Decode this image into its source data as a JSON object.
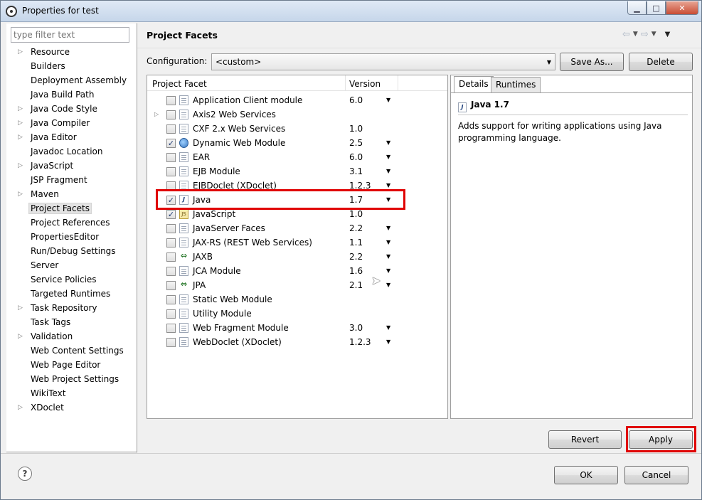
{
  "window": {
    "title": "Properties for test",
    "controls": {
      "minimize": "▁",
      "maximize": "□",
      "close": "✕"
    }
  },
  "sidebar": {
    "filter_placeholder": "type filter text",
    "items": [
      {
        "label": "Resource",
        "expandable": true
      },
      {
        "label": "Builders",
        "expandable": false
      },
      {
        "label": "Deployment Assembly",
        "expandable": false
      },
      {
        "label": "Java Build Path",
        "expandable": false
      },
      {
        "label": "Java Code Style",
        "expandable": true
      },
      {
        "label": "Java Compiler",
        "expandable": true
      },
      {
        "label": "Java Editor",
        "expandable": true
      },
      {
        "label": "Javadoc Location",
        "expandable": false
      },
      {
        "label": "JavaScript",
        "expandable": true
      },
      {
        "label": "JSP Fragment",
        "expandable": false
      },
      {
        "label": "Maven",
        "expandable": true
      },
      {
        "label": "Project Facets",
        "expandable": false,
        "selected": true
      },
      {
        "label": "Project References",
        "expandable": false
      },
      {
        "label": "PropertiesEditor",
        "expandable": false
      },
      {
        "label": "Run/Debug Settings",
        "expandable": false
      },
      {
        "label": "Server",
        "expandable": false
      },
      {
        "label": "Service Policies",
        "expandable": false
      },
      {
        "label": "Targeted Runtimes",
        "expandable": false
      },
      {
        "label": "Task Repository",
        "expandable": true
      },
      {
        "label": "Task Tags",
        "expandable": false
      },
      {
        "label": "Validation",
        "expandable": true
      },
      {
        "label": "Web Content Settings",
        "expandable": false
      },
      {
        "label": "Web Page Editor",
        "expandable": false
      },
      {
        "label": "Web Project Settings",
        "expandable": false
      },
      {
        "label": "WikiText",
        "expandable": false
      },
      {
        "label": "XDoclet",
        "expandable": true
      }
    ]
  },
  "page": {
    "title": "Project Facets",
    "configuration_label": "Configuration:",
    "configuration_value": "<custom>",
    "save_as_label": "Save As...",
    "delete_label": "Delete"
  },
  "facets": {
    "col_facet": "Project Facet",
    "col_version": "Version",
    "rows": [
      {
        "name": "Application Client module",
        "version": "6.0",
        "checked": false,
        "dropdown": true,
        "expander": false,
        "icon": "doc"
      },
      {
        "name": "Axis2 Web Services",
        "version": "",
        "checked": false,
        "dropdown": false,
        "expander": true,
        "icon": "doc"
      },
      {
        "name": "CXF 2.x Web Services",
        "version": "1.0",
        "checked": false,
        "dropdown": false,
        "expander": false,
        "icon": "doc"
      },
      {
        "name": "Dynamic Web Module",
        "version": "2.5",
        "checked": true,
        "dropdown": true,
        "expander": false,
        "icon": "globe"
      },
      {
        "name": "EAR",
        "version": "6.0",
        "checked": false,
        "dropdown": true,
        "expander": false,
        "icon": "doc"
      },
      {
        "name": "EJB Module",
        "version": "3.1",
        "checked": false,
        "dropdown": true,
        "expander": false,
        "icon": "doc"
      },
      {
        "name": "EJBDoclet (XDoclet)",
        "version": "1.2.3",
        "checked": false,
        "dropdown": true,
        "expander": false,
        "icon": "doc"
      },
      {
        "name": "Java",
        "version": "1.7",
        "checked": true,
        "dropdown": true,
        "expander": false,
        "icon": "java"
      },
      {
        "name": "JavaScript",
        "version": "1.0",
        "checked": true,
        "dropdown": false,
        "expander": false,
        "icon": "js"
      },
      {
        "name": "JavaServer Faces",
        "version": "2.2",
        "checked": false,
        "dropdown": true,
        "expander": false,
        "icon": "doc"
      },
      {
        "name": "JAX-RS (REST Web Services)",
        "version": "1.1",
        "checked": false,
        "dropdown": true,
        "expander": false,
        "icon": "doc"
      },
      {
        "name": "JAXB",
        "version": "2.2",
        "checked": false,
        "dropdown": true,
        "expander": false,
        "icon": "xml"
      },
      {
        "name": "JCA Module",
        "version": "1.6",
        "checked": false,
        "dropdown": true,
        "expander": false,
        "icon": "doc"
      },
      {
        "name": "JPA",
        "version": "2.1",
        "checked": false,
        "dropdown": true,
        "expander": false,
        "icon": "xml"
      },
      {
        "name": "Static Web Module",
        "version": "",
        "checked": false,
        "dropdown": false,
        "expander": false,
        "icon": "doc"
      },
      {
        "name": "Utility Module",
        "version": "",
        "checked": false,
        "dropdown": false,
        "expander": false,
        "icon": "doc"
      },
      {
        "name": "Web Fragment Module",
        "version": "3.0",
        "checked": false,
        "dropdown": true,
        "expander": false,
        "icon": "doc"
      },
      {
        "name": "WebDoclet (XDoclet)",
        "version": "1.2.3",
        "checked": false,
        "dropdown": true,
        "expander": false,
        "icon": "doc"
      }
    ]
  },
  "details": {
    "tab_details": "Details",
    "tab_runtimes": "Runtimes",
    "heading": "Java 1.7",
    "description": "Adds support for writing applications using Java programming language."
  },
  "footer": {
    "revert_label": "Revert",
    "apply_label": "Apply",
    "ok_label": "OK",
    "cancel_label": "Cancel",
    "help_glyph": "?"
  },
  "highlight_color": "#e00000"
}
